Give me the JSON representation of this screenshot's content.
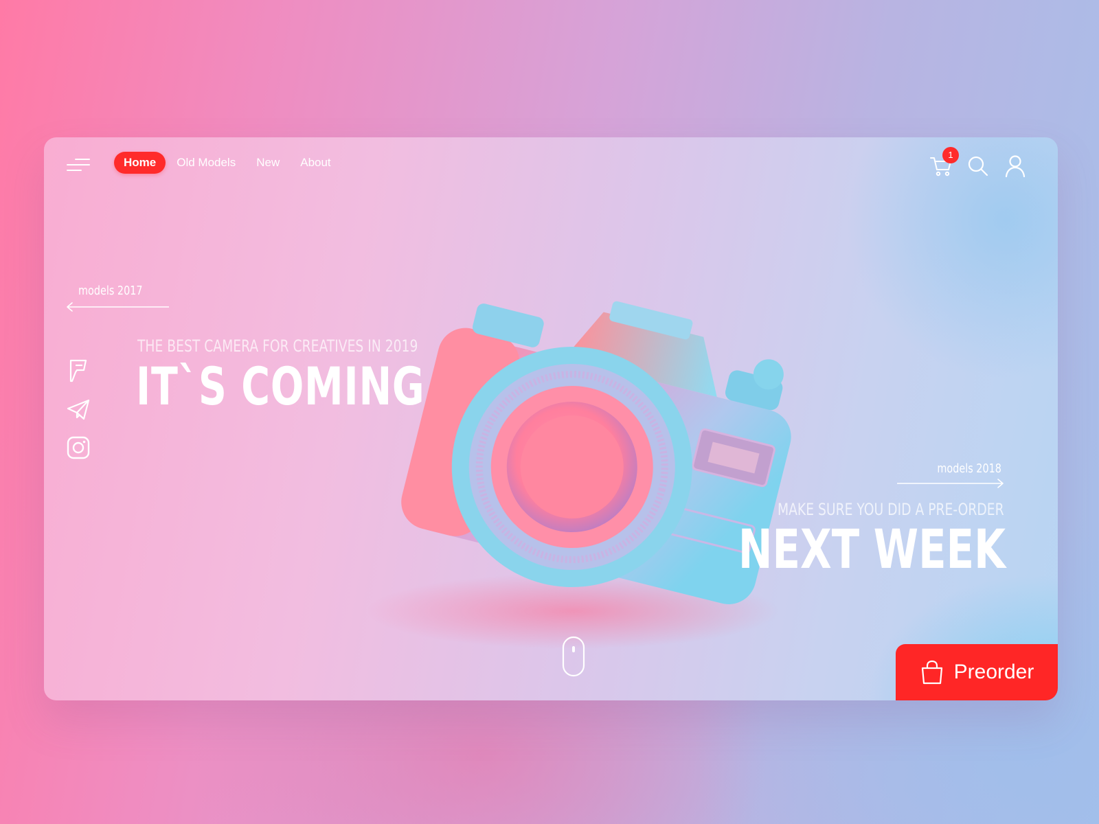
{
  "nav": {
    "items": [
      {
        "label": "Home",
        "active": true
      },
      {
        "label": "Old Models",
        "active": false
      },
      {
        "label": "New",
        "active": false
      },
      {
        "label": "About",
        "active": false
      }
    ]
  },
  "header": {
    "cart_count": "1",
    "icons": [
      "menu-icon",
      "cart-icon",
      "search-icon",
      "user-icon"
    ]
  },
  "left": {
    "models_label": "models 2017",
    "subtitle": "THE BEST CAMERA FOR CREATIVES IN 2019",
    "title": "IT`S COMING",
    "social_icons": [
      "foursquare-icon",
      "telegram-icon",
      "instagram-icon"
    ]
  },
  "right": {
    "models_label": "models 2018",
    "subtitle": "MAKE SURE YOU DID A PRE-ORDER",
    "title": "NEXT WEEK"
  },
  "cta": {
    "preorder_label": "Preorder"
  },
  "colors": {
    "accent": "#ff2626",
    "text": "#ffffff"
  }
}
